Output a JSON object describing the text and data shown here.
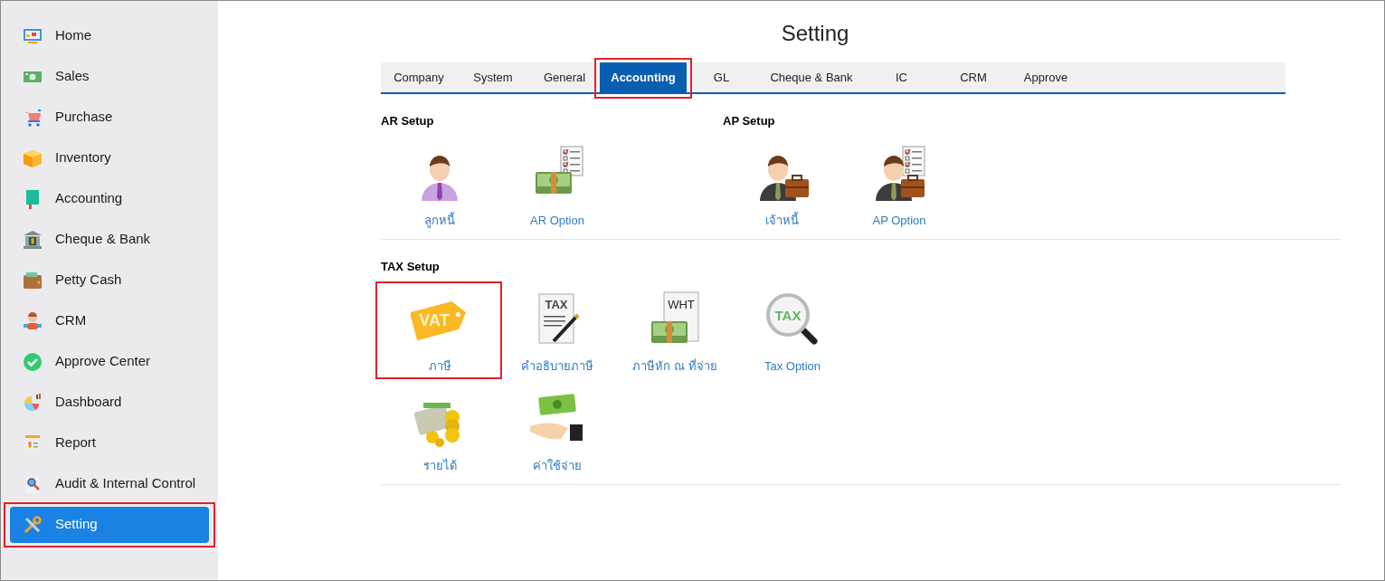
{
  "sidebar": {
    "items": [
      {
        "label": "Home",
        "kind": "monitor",
        "selected": false,
        "highlighted": false
      },
      {
        "label": "Sales",
        "kind": "cash",
        "selected": false,
        "highlighted": false
      },
      {
        "label": "Purchase",
        "kind": "cart",
        "selected": false,
        "highlighted": false
      },
      {
        "label": "Inventory",
        "kind": "box",
        "selected": false,
        "highlighted": false
      },
      {
        "label": "Accounting",
        "kind": "book",
        "selected": false,
        "highlighted": false
      },
      {
        "label": "Cheque & Bank",
        "kind": "bank",
        "selected": false,
        "highlighted": false
      },
      {
        "label": "Petty Cash",
        "kind": "wallet",
        "selected": false,
        "highlighted": false
      },
      {
        "label": "CRM",
        "kind": "people",
        "selected": false,
        "highlighted": false
      },
      {
        "label": "Approve Center",
        "kind": "check",
        "selected": false,
        "highlighted": false
      },
      {
        "label": "Dashboard",
        "kind": "pie",
        "selected": false,
        "highlighted": false
      },
      {
        "label": "Report",
        "kind": "report",
        "selected": false,
        "highlighted": false
      },
      {
        "label": "Audit & Internal Control",
        "kind": "audit",
        "selected": false,
        "highlighted": false
      },
      {
        "label": "Setting",
        "kind": "tools",
        "selected": true,
        "highlighted": true
      }
    ]
  },
  "title": "Setting",
  "tabs": [
    {
      "label": "Company",
      "selected": false,
      "highlighted": false
    },
    {
      "label": "System",
      "selected": false,
      "highlighted": false
    },
    {
      "label": "General",
      "selected": false,
      "highlighted": false
    },
    {
      "label": "Accounting",
      "selected": true,
      "highlighted": true
    },
    {
      "label": "GL",
      "selected": false,
      "highlighted": false
    },
    {
      "label": "Cheque & Bank",
      "selected": false,
      "highlighted": false
    },
    {
      "label": "IC",
      "selected": false,
      "highlighted": false
    },
    {
      "label": "CRM",
      "selected": false,
      "highlighted": false
    },
    {
      "label": "Approve",
      "selected": false,
      "highlighted": false
    }
  ],
  "sections": [
    {
      "groups": [
        {
          "title": "AR Setup",
          "tiles": [
            {
              "label": "ลูกหนี้",
              "kind": "person",
              "highlighted": false
            },
            {
              "label": "AR Option",
              "kind": "money-checklist",
              "highlighted": false
            }
          ]
        },
        {
          "title": "AP Setup",
          "tiles": [
            {
              "label": "เจ้าหนี้",
              "kind": "businessman",
              "highlighted": false
            },
            {
              "label": "AP Option",
              "kind": "businessman-checklist",
              "highlighted": false
            }
          ]
        }
      ]
    },
    {
      "groups": [
        {
          "title": "TAX Setup",
          "tiles": [
            {
              "label": "ภาษี",
              "kind": "tag",
              "icon_text": "VAT",
              "highlighted": true
            },
            {
              "label": "คำอธิบายภาษี",
              "kind": "document-pen",
              "icon_text": "TAX",
              "highlighted": false
            },
            {
              "label": "ภาษีหัก ณ ที่จ่าย",
              "kind": "document-money",
              "icon_text": "WHT",
              "highlighted": false
            },
            {
              "label": "Tax Option",
              "kind": "magnifier",
              "icon_text": "TAX",
              "highlighted": false
            },
            {
              "label": "รายได้",
              "kind": "money-coins",
              "highlighted": false
            },
            {
              "label": "ค่าใช้จ่าย",
              "kind": "hand-money",
              "highlighted": false
            }
          ]
        }
      ]
    }
  ]
}
